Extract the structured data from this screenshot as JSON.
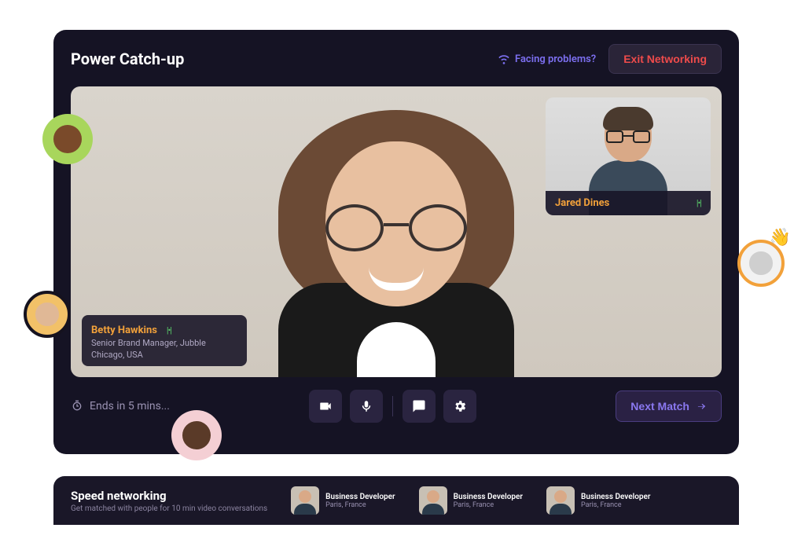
{
  "header": {
    "title": "Power Catch-up",
    "facing_problems": "Facing problems?",
    "exit_label": "Exit Networking"
  },
  "call": {
    "main_speaker": {
      "name": "Betty Hawkins",
      "title": "Senior Brand Manager, Jubble",
      "location": "Chicago, USA"
    },
    "pip_speaker": {
      "name": "Jared Dines"
    },
    "timer": "Ends in 5 mins...",
    "next_match_label": "Next Match"
  },
  "networking_strip": {
    "title": "Speed networking",
    "subtitle": "Get matched with people for 10 min video conversations",
    "matches": [
      {
        "role": "Business Developer",
        "location": "Paris, France"
      },
      {
        "role": "Business Developer",
        "location": "Paris, France"
      },
      {
        "role": "Business Developer",
        "location": "Paris, France"
      }
    ]
  },
  "colors": {
    "accent_purple": "#8a78f0",
    "accent_orange": "#f2a13a",
    "danger": "#ef4b4b",
    "speaking_green": "#5bd16b"
  }
}
